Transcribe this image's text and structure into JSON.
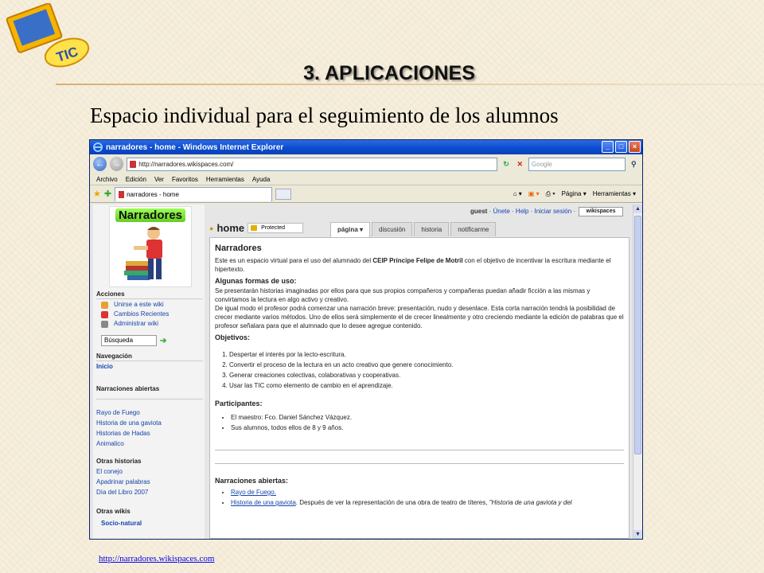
{
  "slide": {
    "title": "3. APLICACIONES",
    "subtitle": "Espacio individual para el seguimiento  de los alumnos",
    "logo_text": "TIC",
    "source_url": "http://narradores.wikispaces.com"
  },
  "browser": {
    "window_title": "narradores - home - Windows Internet Explorer",
    "address": "http://narradores.wikispaces.com/",
    "search_placeholder": "Google",
    "menu": [
      "Archivo",
      "Edición",
      "Ver",
      "Favoritos",
      "Herramientas",
      "Ayuda"
    ],
    "tab_label": "narradores - home",
    "commands": [
      "Página ▾",
      "Herramientas ▾"
    ],
    "win_buttons": [
      "_",
      "□",
      "×"
    ]
  },
  "sidebar": {
    "logo_title": "Narradores",
    "acciones_head": "Acciones",
    "acciones": [
      "Unirse a este wiki",
      "Cambios Recientes",
      "Administrar wiki"
    ],
    "search_value": "Búsqueda",
    "navegacion_head": "Navegación",
    "inicio": "Inicio",
    "narraciones_head": "Narraciones abiertas",
    "narraciones": [
      "Rayo de Fuego",
      "Historia de una gaviota",
      "Historias de Hadas",
      "Animalico"
    ],
    "otras_historias_head": "Otras historias",
    "otras_historias": [
      "El conejo",
      "Apadrinar palabras",
      "Día del Libro 2007"
    ],
    "otras_wikis_head": "Otras wikis",
    "otras_wikis": [
      "Socio-natural"
    ]
  },
  "wiki": {
    "user_guest": "guest",
    "user_links": "· Únete · Help · Iniciar sesión ·",
    "badge": "wikispaces",
    "home_label": "home",
    "protected_label": "Protected",
    "tabs": [
      "página ▾",
      "discusión",
      "historia",
      "notificarme"
    ],
    "page_title": "Narradores",
    "intro_a": "Este es un espacio virtual para el uso del alumnado del ",
    "intro_school": "CEIP Príncipe Felipe de Motril",
    "intro_b": " con el objetivo de incentivar la escritura mediante el hipertexto.",
    "formas_head": "Algunas formas de uso:",
    "formas_p1": "Se presentarán historias imaginadas por ellos para que sus propios compañeros y compañeras puedan añadir ficción a las mismas y convirtamos la lectura en algo activo y creativo.",
    "formas_p2": "De igual modo el profesor podrá comenzar una narración breve: presentación, nudo y desenlace. Esta corta narración tendrá la posibilidad de crecer mediante varios métodos. Uno de ellos será simplemente el de crecer linealmente y otro creciendo mediante la edición de palabras que el profesor señalara para que el alumnado que lo desee agregue contenido.",
    "objetivos_head": "Objetivos:",
    "objetivos": [
      "Despertar el interés por la lecto-escritura.",
      "Convertir el proceso de la lectura en un acto creativo que genere conocimiento.",
      "Generar creaciones colectivas, colaborativas y cooperativas.",
      "Usar las TIC como elemento de cambio en el aprendizaje."
    ],
    "participantes_head": "Participantes:",
    "participantes": [
      "El maestro: Fco. Daniel Sánchez Vázquez.",
      "Sus alumnos, todos ellos de 8 y 9 años."
    ],
    "narraciones_head": "Narraciones abiertas:",
    "narr_link1": "Rayo de Fuego.",
    "narr_link2": "Historia de una gaviota",
    "narr_text2": ". Después de ver la representación de una obra de teatro de títeres, ",
    "narr_text2_em": "\"Historia de una gaviota y del"
  }
}
